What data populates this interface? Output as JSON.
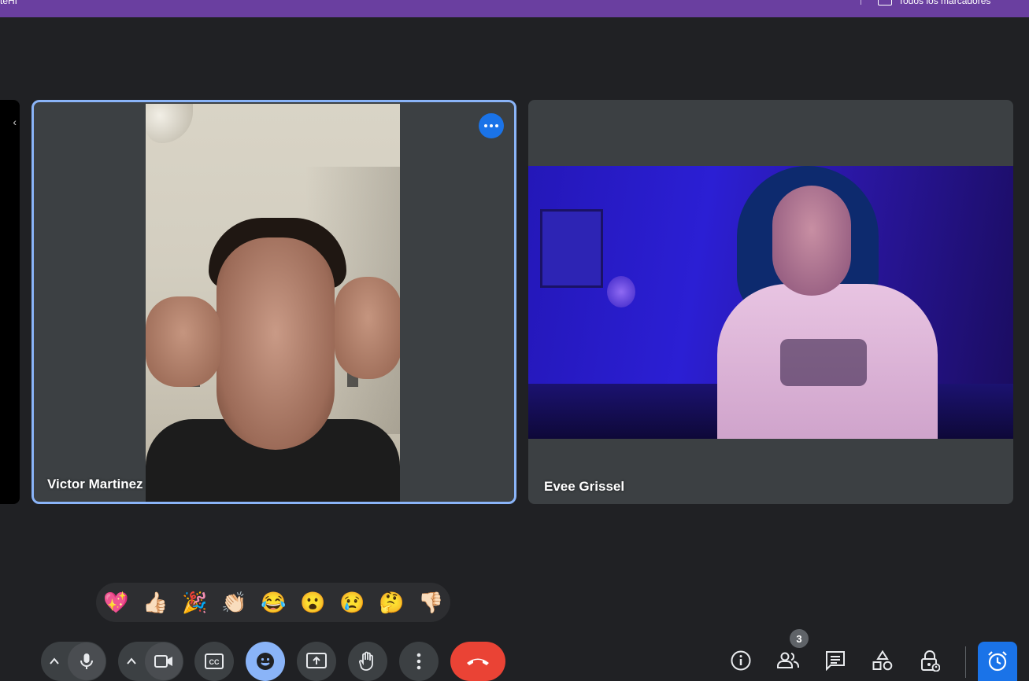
{
  "bookmarks_bar": {
    "left_text": "teHI",
    "all_bookmarks": "Todos los marcadores"
  },
  "tiles": {
    "victor": {
      "name": "Victor Martinez"
    },
    "evee": {
      "name": "Evee Grissel"
    }
  },
  "reactions": [
    "💖",
    "👍🏻",
    "🎉",
    "👏🏻",
    "😂",
    "😮",
    "😢",
    "🤔",
    "👎🏻"
  ],
  "participants_count": "3",
  "colors": {
    "accent": "#8ab4f8",
    "hangup": "#ea4335",
    "active_blue": "#1a73e8",
    "background": "#202124",
    "tile": "#3c4043",
    "bookmarks_bar": "#6a3fa0"
  },
  "icons": {
    "mic": "mic-icon",
    "camera": "camera-icon",
    "captions": "closed-captions-icon",
    "emoji": "emoji-icon",
    "present": "present-screen-icon",
    "raise_hand": "raise-hand-icon",
    "more": "more-options-icon",
    "hangup": "hangup-icon",
    "info": "info-icon",
    "people": "people-icon",
    "chat": "chat-icon",
    "activities": "activities-icon",
    "host_controls": "host-controls-icon",
    "timer": "timer-icon"
  }
}
